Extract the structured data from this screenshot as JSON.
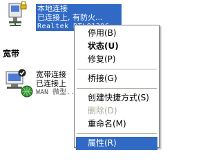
{
  "connections": [
    {
      "name": "本地连接",
      "status": "已连接上, 有防火...",
      "device": "Realtek RTL8139C..."
    }
  ],
  "section": {
    "title": "宽带"
  },
  "broadband": [
    {
      "name": "宽带连接",
      "status": "已连接上",
      "device": "WAN 微型..."
    }
  ],
  "context_menu": {
    "items": [
      {
        "label": "停用(B)",
        "bold": false,
        "disabled": false
      },
      {
        "label": "状态(U)",
        "bold": true,
        "disabled": false
      },
      {
        "label": "修复(P)",
        "bold": false,
        "disabled": false
      },
      {
        "separator": true
      },
      {
        "label": "桥接(G)",
        "bold": false,
        "disabled": false
      },
      {
        "separator": true
      },
      {
        "label": "创建快捷方式(S)",
        "bold": false,
        "disabled": false
      },
      {
        "label": "删除(D)",
        "bold": false,
        "disabled": true
      },
      {
        "label": "重命名(M)",
        "bold": false,
        "disabled": false
      },
      {
        "separator": true
      },
      {
        "label": "属性(R)",
        "bold": false,
        "disabled": false,
        "active": true
      }
    ]
  },
  "colors": {
    "selection": "#316ac5",
    "disabled_text": "#aca899"
  },
  "icons": [
    "network-connection-icon",
    "firewall-lock-icon",
    "broadband-connection-icon",
    "connected-check-icon",
    "globe-icon"
  ]
}
